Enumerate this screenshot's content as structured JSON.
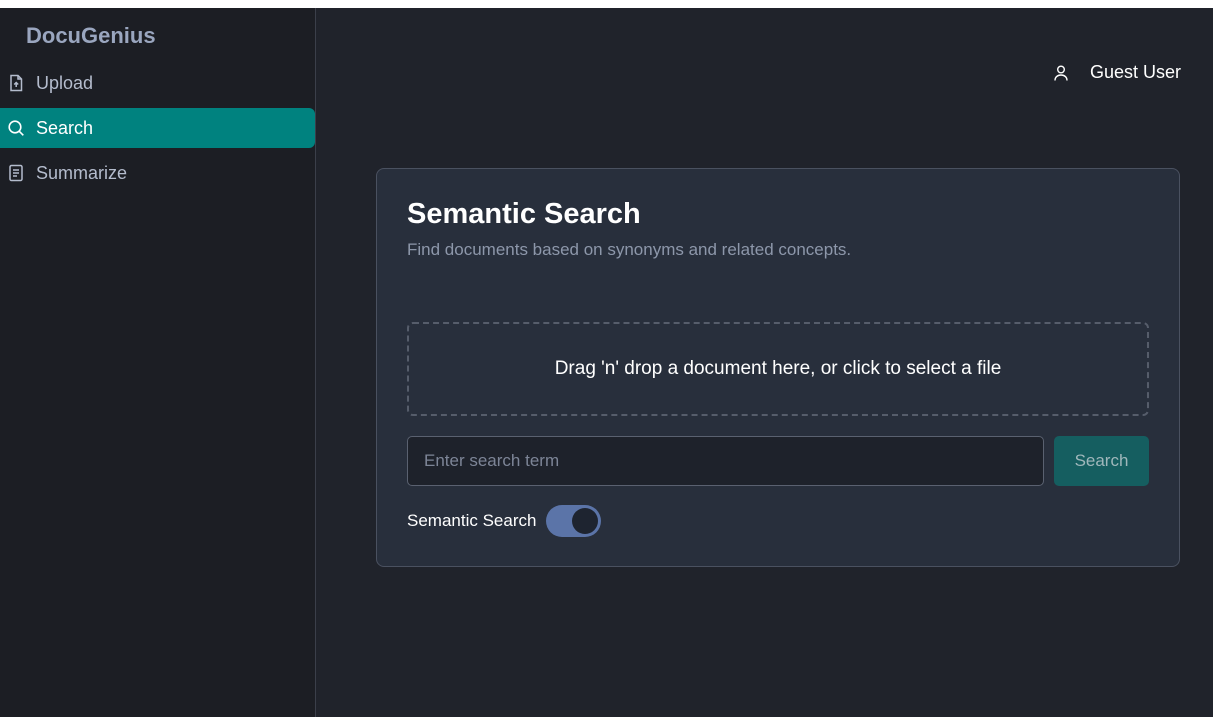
{
  "app": {
    "brand": "DocuGenius"
  },
  "sidebar": {
    "items": [
      {
        "label": "Upload",
        "icon": "file-upload-icon",
        "active": false
      },
      {
        "label": "Search",
        "icon": "search-icon",
        "active": true
      },
      {
        "label": "Summarize",
        "icon": "document-icon",
        "active": false
      }
    ]
  },
  "header": {
    "user_name": "Guest User",
    "user_icon": "user-icon"
  },
  "card": {
    "title": "Semantic Search",
    "subtitle": "Find documents based on synonyms and related concepts.",
    "dropzone_text": "Drag 'n' drop a document here, or click to select a file",
    "search": {
      "placeholder": "Enter search term",
      "value": "",
      "button_label": "Search"
    },
    "toggle": {
      "label": "Semantic Search",
      "on": true
    }
  },
  "colors": {
    "accent": "#00827f",
    "background": "#20232b",
    "sidebar": "#1c1e24",
    "card": "#282f3c",
    "toggle_on": "#5b74a8"
  }
}
